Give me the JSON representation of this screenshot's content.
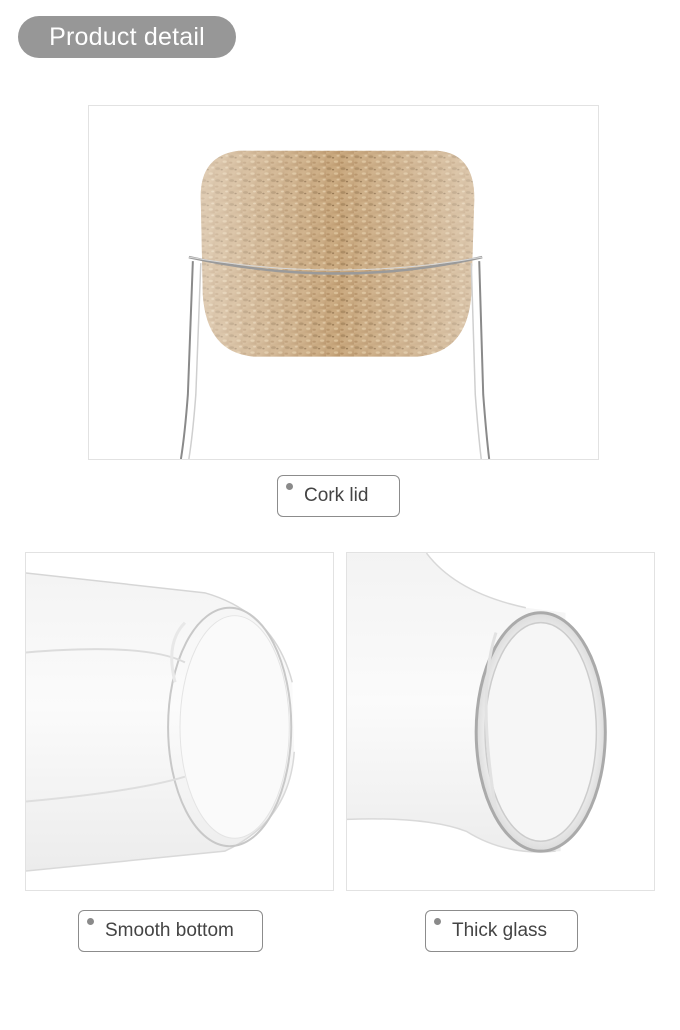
{
  "header": {
    "title": "Product detail"
  },
  "panels": {
    "cork": {
      "caption": "Cork lid"
    },
    "bottom": {
      "caption": "Smooth bottom"
    },
    "glass": {
      "caption": "Thick glass"
    }
  },
  "colors": {
    "header_bg": "#979797",
    "cork": "#c9a77b",
    "caption_border": "#8c8c8c"
  }
}
